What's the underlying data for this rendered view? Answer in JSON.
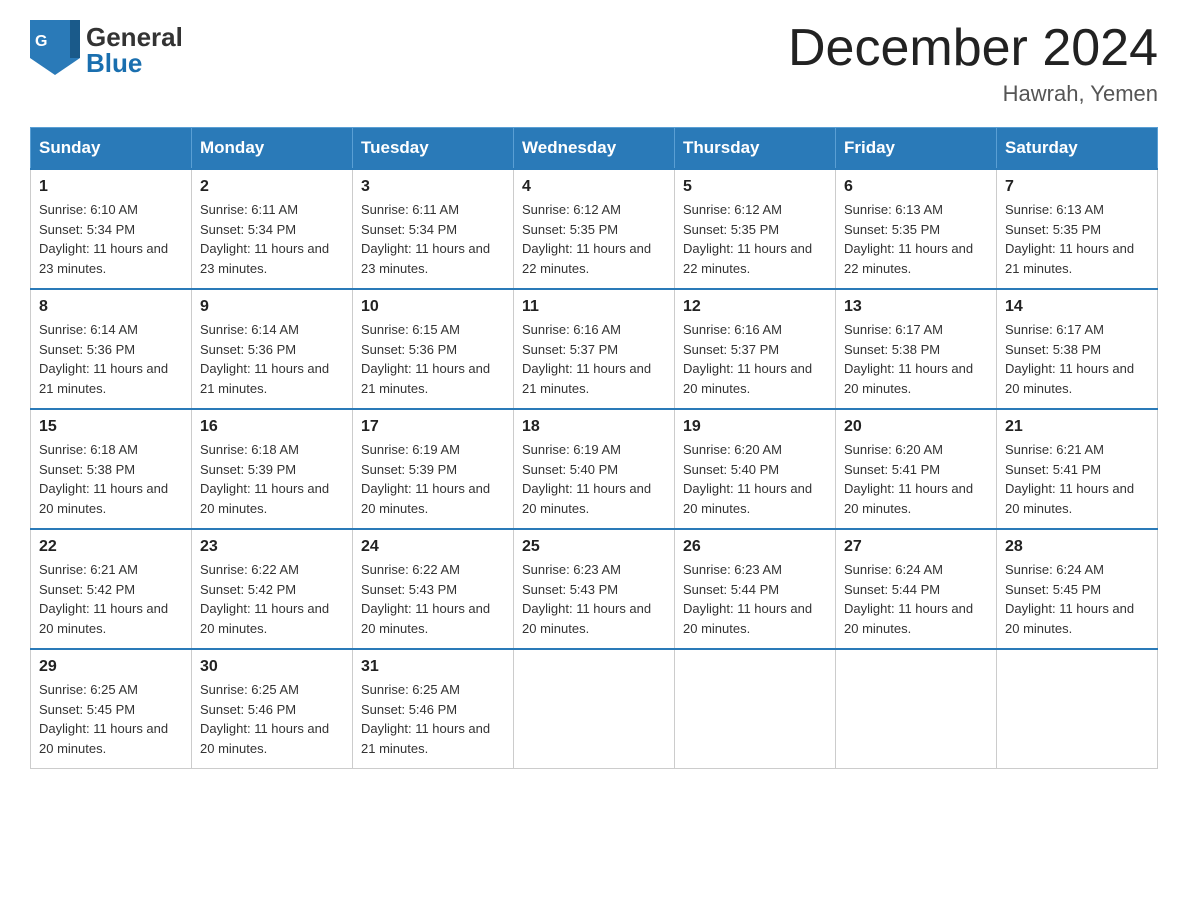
{
  "logo": {
    "general": "General",
    "blue": "Blue",
    "icon_color": "#1a6faf"
  },
  "header": {
    "month_year": "December 2024",
    "location": "Hawrah, Yemen"
  },
  "weekdays": [
    "Sunday",
    "Monday",
    "Tuesday",
    "Wednesday",
    "Thursday",
    "Friday",
    "Saturday"
  ],
  "weeks": [
    [
      {
        "day": "1",
        "sunrise": "Sunrise: 6:10 AM",
        "sunset": "Sunset: 5:34 PM",
        "daylight": "Daylight: 11 hours and 23 minutes."
      },
      {
        "day": "2",
        "sunrise": "Sunrise: 6:11 AM",
        "sunset": "Sunset: 5:34 PM",
        "daylight": "Daylight: 11 hours and 23 minutes."
      },
      {
        "day": "3",
        "sunrise": "Sunrise: 6:11 AM",
        "sunset": "Sunset: 5:34 PM",
        "daylight": "Daylight: 11 hours and 23 minutes."
      },
      {
        "day": "4",
        "sunrise": "Sunrise: 6:12 AM",
        "sunset": "Sunset: 5:35 PM",
        "daylight": "Daylight: 11 hours and 22 minutes."
      },
      {
        "day": "5",
        "sunrise": "Sunrise: 6:12 AM",
        "sunset": "Sunset: 5:35 PM",
        "daylight": "Daylight: 11 hours and 22 minutes."
      },
      {
        "day": "6",
        "sunrise": "Sunrise: 6:13 AM",
        "sunset": "Sunset: 5:35 PM",
        "daylight": "Daylight: 11 hours and 22 minutes."
      },
      {
        "day": "7",
        "sunrise": "Sunrise: 6:13 AM",
        "sunset": "Sunset: 5:35 PM",
        "daylight": "Daylight: 11 hours and 21 minutes."
      }
    ],
    [
      {
        "day": "8",
        "sunrise": "Sunrise: 6:14 AM",
        "sunset": "Sunset: 5:36 PM",
        "daylight": "Daylight: 11 hours and 21 minutes."
      },
      {
        "day": "9",
        "sunrise": "Sunrise: 6:14 AM",
        "sunset": "Sunset: 5:36 PM",
        "daylight": "Daylight: 11 hours and 21 minutes."
      },
      {
        "day": "10",
        "sunrise": "Sunrise: 6:15 AM",
        "sunset": "Sunset: 5:36 PM",
        "daylight": "Daylight: 11 hours and 21 minutes."
      },
      {
        "day": "11",
        "sunrise": "Sunrise: 6:16 AM",
        "sunset": "Sunset: 5:37 PM",
        "daylight": "Daylight: 11 hours and 21 minutes."
      },
      {
        "day": "12",
        "sunrise": "Sunrise: 6:16 AM",
        "sunset": "Sunset: 5:37 PM",
        "daylight": "Daylight: 11 hours and 20 minutes."
      },
      {
        "day": "13",
        "sunrise": "Sunrise: 6:17 AM",
        "sunset": "Sunset: 5:38 PM",
        "daylight": "Daylight: 11 hours and 20 minutes."
      },
      {
        "day": "14",
        "sunrise": "Sunrise: 6:17 AM",
        "sunset": "Sunset: 5:38 PM",
        "daylight": "Daylight: 11 hours and 20 minutes."
      }
    ],
    [
      {
        "day": "15",
        "sunrise": "Sunrise: 6:18 AM",
        "sunset": "Sunset: 5:38 PM",
        "daylight": "Daylight: 11 hours and 20 minutes."
      },
      {
        "day": "16",
        "sunrise": "Sunrise: 6:18 AM",
        "sunset": "Sunset: 5:39 PM",
        "daylight": "Daylight: 11 hours and 20 minutes."
      },
      {
        "day": "17",
        "sunrise": "Sunrise: 6:19 AM",
        "sunset": "Sunset: 5:39 PM",
        "daylight": "Daylight: 11 hours and 20 minutes."
      },
      {
        "day": "18",
        "sunrise": "Sunrise: 6:19 AM",
        "sunset": "Sunset: 5:40 PM",
        "daylight": "Daylight: 11 hours and 20 minutes."
      },
      {
        "day": "19",
        "sunrise": "Sunrise: 6:20 AM",
        "sunset": "Sunset: 5:40 PM",
        "daylight": "Daylight: 11 hours and 20 minutes."
      },
      {
        "day": "20",
        "sunrise": "Sunrise: 6:20 AM",
        "sunset": "Sunset: 5:41 PM",
        "daylight": "Daylight: 11 hours and 20 minutes."
      },
      {
        "day": "21",
        "sunrise": "Sunrise: 6:21 AM",
        "sunset": "Sunset: 5:41 PM",
        "daylight": "Daylight: 11 hours and 20 minutes."
      }
    ],
    [
      {
        "day": "22",
        "sunrise": "Sunrise: 6:21 AM",
        "sunset": "Sunset: 5:42 PM",
        "daylight": "Daylight: 11 hours and 20 minutes."
      },
      {
        "day": "23",
        "sunrise": "Sunrise: 6:22 AM",
        "sunset": "Sunset: 5:42 PM",
        "daylight": "Daylight: 11 hours and 20 minutes."
      },
      {
        "day": "24",
        "sunrise": "Sunrise: 6:22 AM",
        "sunset": "Sunset: 5:43 PM",
        "daylight": "Daylight: 11 hours and 20 minutes."
      },
      {
        "day": "25",
        "sunrise": "Sunrise: 6:23 AM",
        "sunset": "Sunset: 5:43 PM",
        "daylight": "Daylight: 11 hours and 20 minutes."
      },
      {
        "day": "26",
        "sunrise": "Sunrise: 6:23 AM",
        "sunset": "Sunset: 5:44 PM",
        "daylight": "Daylight: 11 hours and 20 minutes."
      },
      {
        "day": "27",
        "sunrise": "Sunrise: 6:24 AM",
        "sunset": "Sunset: 5:44 PM",
        "daylight": "Daylight: 11 hours and 20 minutes."
      },
      {
        "day": "28",
        "sunrise": "Sunrise: 6:24 AM",
        "sunset": "Sunset: 5:45 PM",
        "daylight": "Daylight: 11 hours and 20 minutes."
      }
    ],
    [
      {
        "day": "29",
        "sunrise": "Sunrise: 6:25 AM",
        "sunset": "Sunset: 5:45 PM",
        "daylight": "Daylight: 11 hours and 20 minutes."
      },
      {
        "day": "30",
        "sunrise": "Sunrise: 6:25 AM",
        "sunset": "Sunset: 5:46 PM",
        "daylight": "Daylight: 11 hours and 20 minutes."
      },
      {
        "day": "31",
        "sunrise": "Sunrise: 6:25 AM",
        "sunset": "Sunset: 5:46 PM",
        "daylight": "Daylight: 11 hours and 21 minutes."
      },
      null,
      null,
      null,
      null
    ]
  ]
}
